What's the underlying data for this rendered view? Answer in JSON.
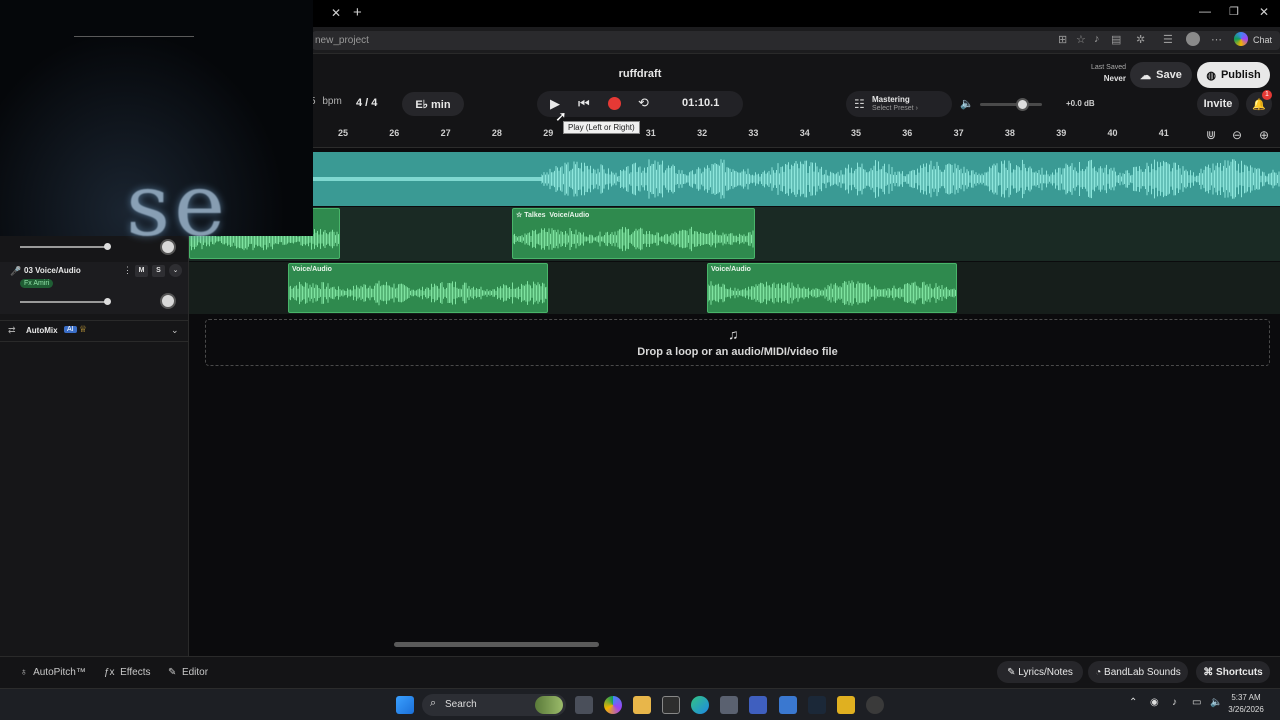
{
  "browser": {
    "url": "new_project",
    "chat_label": "Chat"
  },
  "overlay": {
    "text": "se"
  },
  "header": {
    "project_title": "ruffdraft",
    "bpm_value": "5",
    "bpm_unit": "bpm",
    "time_signature": "4 / 4",
    "key": "E♭ min",
    "timecode": "01:10.1",
    "play_tooltip": "Play (Left or Right)",
    "mastering_label": "Mastering",
    "mastering_preset": "Select Preset ›",
    "volume_db": "+0.0 dB",
    "volume_level": 0.7,
    "last_saved_label": "Last Saved",
    "last_saved_value": "Never",
    "save_label": "Save",
    "publish_label": "Publish",
    "invite_label": "Invite",
    "notification_count": "1"
  },
  "ruler": {
    "bars": [
      "25",
      "26",
      "27",
      "28",
      "29",
      "31",
      "32",
      "33",
      "34",
      "35",
      "36",
      "37",
      "38",
      "39",
      "40",
      "41"
    ]
  },
  "tracks": [
    {
      "clips": [
        {
          "label": "Talkes",
          "label_b": "Voice/Audio"
        }
      ]
    },
    {
      "name": "03 Voice/Audio",
      "fx": "Fx Amiri",
      "mute": "M",
      "solo": "S",
      "clips": [
        {
          "label": "Voice/Audio"
        },
        {
          "label": "Voice/Audio"
        }
      ]
    }
  ],
  "dropzone": {
    "text": "Drop a loop or an audio/MIDI/video file"
  },
  "automix": {
    "label": "AutoMix",
    "badge": "AI"
  },
  "bottombar": {
    "autopitch": "AutoPitch™",
    "effects": "Effects",
    "editor": "Editor",
    "lyrics": "Lyrics/Notes",
    "bandlab_sounds": "BandLab Sounds",
    "shortcuts": "Shortcuts"
  },
  "taskbar": {
    "search": "Search",
    "time": "5:37 AM",
    "date": "3/26/2026"
  },
  "colors": {
    "accent_teal": "#3a9a94",
    "clip_green": "#2f8a4e",
    "record_red": "#e53935"
  }
}
